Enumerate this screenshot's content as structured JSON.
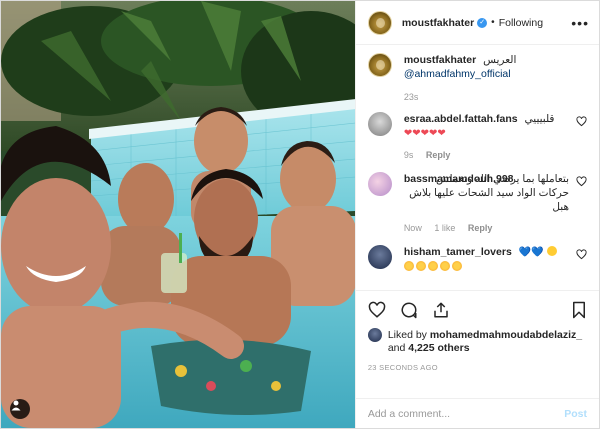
{
  "post": {
    "author": "moustfakhater",
    "following_label": "Following",
    "more_icon": "more-options-icon",
    "photo_icon": "user-tag-icon"
  },
  "caption": {
    "username": "moustfakhater",
    "text": "العريس",
    "mention": "@ahmadfahmy_official",
    "time": "23s"
  },
  "comments": [
    {
      "username": "esraa.abdel.fattah.fans",
      "text": "قلبيييي",
      "emoji": "❤❤❤❤❤",
      "time": "9s",
      "reply": "Reply"
    },
    {
      "username": "bassmamamdouh.998",
      "text": "بتعاملها بما يرضي الله وتعملش حركات الواد سيد الشحات عليها بلاش هبل",
      "time": "Now",
      "likes": "1 like",
      "reply": "Reply"
    },
    {
      "username": "hisham_tamer_lovers",
      "emoji": "💙💙",
      "time": "",
      "reply": ""
    }
  ],
  "actions": {
    "like_icon": "heart-icon",
    "comment_icon": "comment-icon",
    "share_icon": "share-icon",
    "save_icon": "bookmark-icon"
  },
  "likes": {
    "prefix": "Liked by",
    "user": "mohamedmahmoudabdelaziz_",
    "and": "and",
    "others": "4,225 others"
  },
  "timestamp": "23 SECONDS AGO",
  "add_comment": {
    "placeholder": "Add a comment...",
    "post_label": "Post"
  },
  "colors": {
    "verified": "#3897f0",
    "heart": "#ed4956",
    "link": "#003569",
    "post_button_disabled": "#b2dffc"
  }
}
